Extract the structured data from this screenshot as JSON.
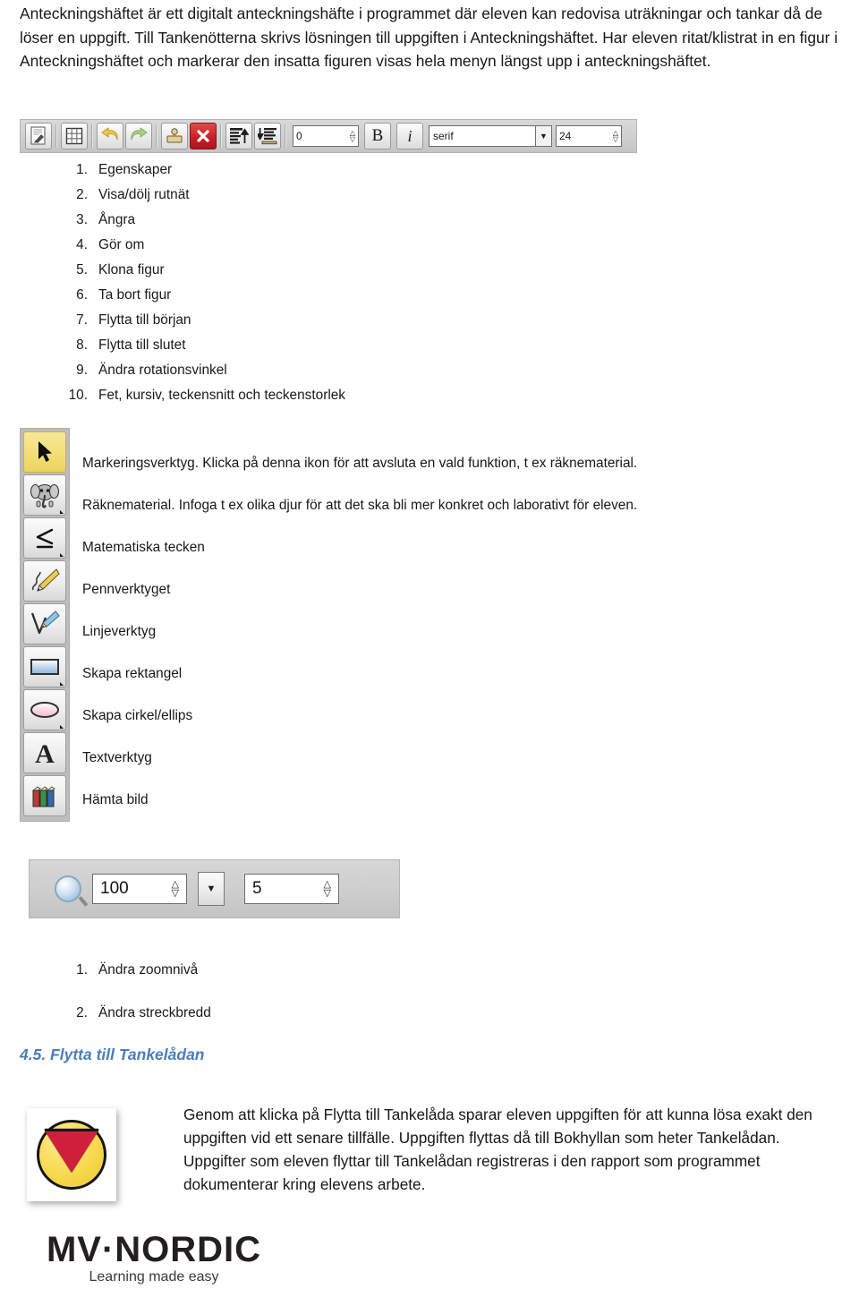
{
  "intro": {
    "paragraph": "Anteckningshäftet är ett digitalt anteckningshäfte i programmet där eleven kan redovisa uträkningar och tankar då de löser en uppgift. Till Tankenötterna skrivs lösningen till uppgiften i Anteckningshäftet. Har eleven ritat/klistrat in en figur i Anteckningshäftet och markerar den insatta figuren visas hela menyn längst upp i anteckningshäftet."
  },
  "top_toolbar": {
    "buttons": [
      {
        "icon": "properties-icon",
        "name": "properties-button"
      },
      {
        "icon": "grid-icon",
        "name": "grid-toggle-button"
      },
      {
        "icon": "undo-icon",
        "name": "undo-button"
      },
      {
        "icon": "redo-icon",
        "name": "redo-button"
      },
      {
        "icon": "clone-figure-icon",
        "name": "clone-figure-button"
      },
      {
        "icon": "delete-x-icon",
        "name": "delete-figure-button"
      },
      {
        "icon": "move-to-front-icon",
        "name": "move-to-front-button"
      },
      {
        "icon": "move-to-back-icon",
        "name": "move-to-back-button"
      }
    ],
    "rotation_value": "0",
    "bold_label": "B",
    "italic_label": "i",
    "font_value": "serif",
    "font_size_value": "24"
  },
  "menu_list": [
    {
      "num": "1.",
      "label": "Egenskaper"
    },
    {
      "num": "2.",
      "label": "Visa/dölj rutnät"
    },
    {
      "num": "3.",
      "label": "Ångra"
    },
    {
      "num": "4.",
      "label": "Gör om"
    },
    {
      "num": "5.",
      "label": "Klona figur"
    },
    {
      "num": "6.",
      "label": "Ta bort figur"
    },
    {
      "num": "7.",
      "label": "Flytta till början"
    },
    {
      "num": "8.",
      "label": "Flytta till slutet"
    },
    {
      "num": "9.",
      "label": "Ändra rotationsvinkel"
    },
    {
      "num": "10.",
      "label": "Fet, kursiv, teckensnitt och teckenstorlek"
    }
  ],
  "tools": [
    {
      "icon": "cursor-arrow-icon",
      "selected": true,
      "submenu": false,
      "description": "Markeringsverktyg. Klicka på denna ikon för att avsluta en vald funktion, t ex räknematerial."
    },
    {
      "icon": "elephant-icon",
      "selected": false,
      "submenu": true,
      "description": "Räknematerial. Infoga t ex olika djur för att det ska bli mer konkret och laborativt för eleven."
    },
    {
      "icon": "math-symbol-icon",
      "selected": false,
      "submenu": true,
      "description": "Matematiska tecken"
    },
    {
      "icon": "pencil-icon",
      "selected": false,
      "submenu": false,
      "description": "Pennverktyget"
    },
    {
      "icon": "line-pen-icon",
      "selected": false,
      "submenu": false,
      "description": "Linjeverktyg"
    },
    {
      "icon": "rectangle-icon",
      "selected": false,
      "submenu": true,
      "description": "Skapa rektangel"
    },
    {
      "icon": "ellipse-icon",
      "selected": false,
      "submenu": true,
      "description": "Skapa cirkel/ellips"
    },
    {
      "icon": "text-a-icon",
      "selected": false,
      "submenu": false,
      "description": "Textverktyg"
    },
    {
      "icon": "books-icon",
      "selected": false,
      "submenu": false,
      "description": "Hämta bild"
    }
  ],
  "zoom_toolbar": {
    "magnifier_icon": "magnifier-icon",
    "zoom_value": "100",
    "dropdown_icon": "chevron-down-icon",
    "stroke_width_value": "5"
  },
  "zoom_list": [
    {
      "num": "1.",
      "label": "Ändra zoomnivå"
    },
    {
      "num": "2.",
      "label": "Ändra streckbredd"
    }
  ],
  "section": {
    "heading": "4.5. Flytta till Tankelådan",
    "body": "Genom att klicka på Flytta till Tankelåda sparar eleven uppgiften för att kunna lösa exakt den uppgiften vid ett senare tillfälle. Uppgiften flyttas då till Bokhyllan som heter Tankelådan. Uppgifter som eleven flyttar till Tankelådan registreras i den rapport som programmet dokumenterar kring elevens arbete."
  },
  "logo": {
    "title": "MV·NORDIC",
    "tagline": "Learning made easy"
  },
  "colors": {
    "heading_blue": "#4a7ebb",
    "selected_tool_yellow": "#f2de78",
    "delete_red": "#cc2028",
    "undo_yellow": "#e8c13a",
    "redo_green": "#8fbf5a",
    "tankelada_yellow": "#f7d94f",
    "tankelada_red": "#cf1f3d"
  }
}
